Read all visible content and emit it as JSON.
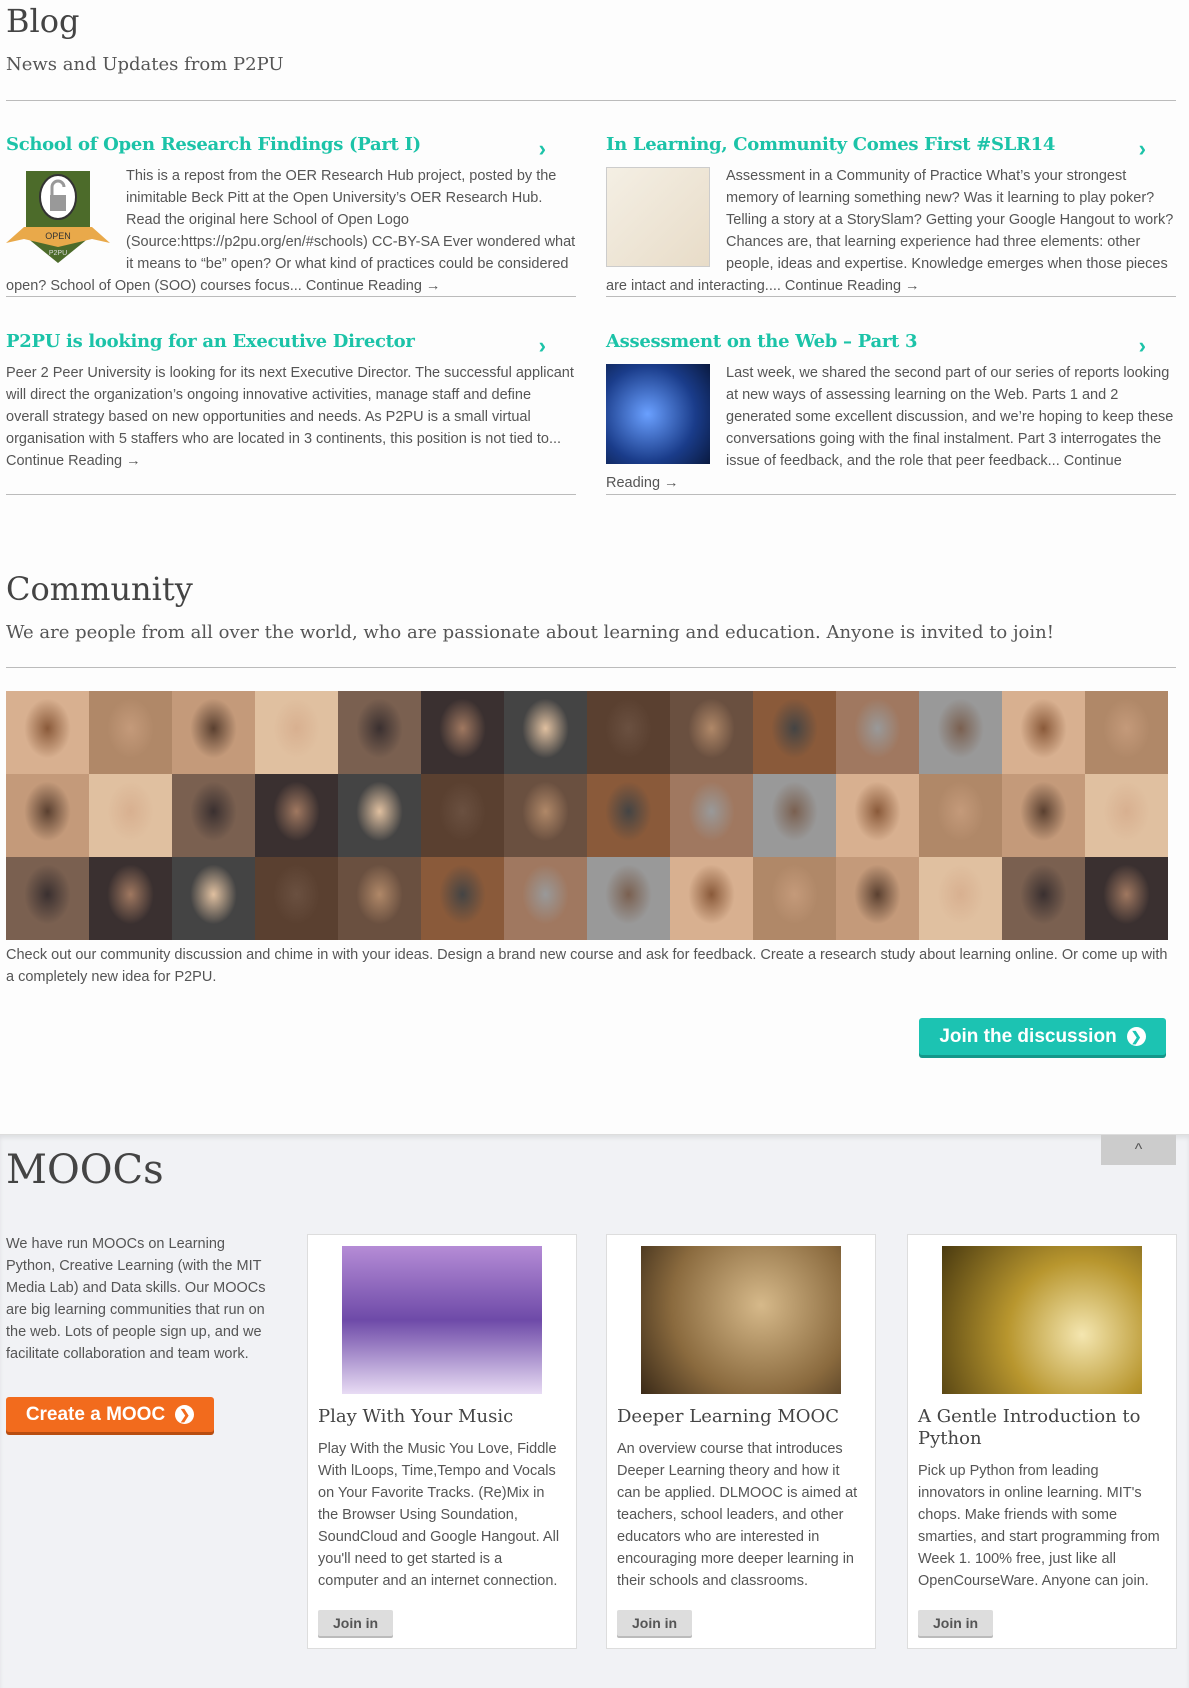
{
  "blog": {
    "title": "Blog",
    "subtitle": "News and Updates from P2PU",
    "posts": [
      {
        "title": "School of Open Research Findings (Part I)",
        "text": "This is a repost from the OER Research Hub project, posted by the inimitable Beck Pitt at the Open University’s OER Research Hub. Read the original here   School of Open Logo (Source:https://p2pu.org/en/#schools) CC-BY-SA Ever wondered what it means to “be” open? Or what kind of practices could be considered open? School of Open (SOO) courses focus... Continue Reading →",
        "badge_top": "OPEN",
        "badge_bottom": "P2PU"
      },
      {
        "title": "In Learning, Community Comes First #SLR14",
        "text": "  Assessment in a Community of Practice What’s your strongest memory of learning something new? Was it learning to play poker? Telling a story at a StorySlam? Getting your Google Hangout to work? Chances are, that learning experience had three elements: other people, ideas and expertise. Knowledge emerges when those pieces are intact and interacting.... Continue Reading →"
      },
      {
        "title": "P2PU is looking for an Executive Director",
        "text": "Peer 2 Peer University is looking for its next Executive Director. The successful applicant will direct the organization’s ongoing innovative activities, manage staff and define overall strategy based on new opportunities and needs. As P2PU is a small virtual organisation with 5 staffers who are located in 3 continents, this position is not tied to... Continue Reading →"
      },
      {
        "title": "Assessment on the Web – Part 3",
        "text": "Last week, we shared the second part of our series of reports looking at new ways of assessing learning on the Web. Parts 1 and 2 generated some excellent discussion, and we’re hoping to keep these conversations going with the final instalment. Part 3 interrogates the issue of feedback, and the role that peer feedback... Continue Reading →"
      }
    ]
  },
  "community": {
    "title": "Community",
    "subtitle": "We are people from all over the world, who are passionate about learning and education. Anyone is invited to join!",
    "text": "Check out our community discussion and chime in with your ideas. Design a brand new course and ask for feedback. Create a research study about learning online. Or come up with a completely new idea for P2PU.",
    "button": "Join the discussion",
    "accent": "#1cc3b2"
  },
  "moocs": {
    "title": "MOOCs",
    "text": "We have run MOOCs on Learning Python, Creative Learning (with the MIT Media Lab) and Data skills. Our MOOCs are big learning communities that run on the web. Lots of people sign up, and we facilitate collaboration and team work.",
    "button": "Create a MOOC",
    "accent": "#f26b1d",
    "cards": [
      {
        "title": "Play With Your Music",
        "text": "Play With the Music You Love, Fiddle With lLoops, Time,Tempo and Vocals on Your Favorite Tracks. (Re)Mix in the Browser Using Soundation, SoundCloud and Google Hangout. All you'll need to get started is a computer and an internet connection.",
        "button": "Join in"
      },
      {
        "title": "Deeper Learning MOOC",
        "text": "An overview course that introduces Deeper Learning theory and how it can be applied. DLMOOC is aimed at teachers, school leaders, and other educators who are interested in encouraging more deeper learning in their schools and classrooms.",
        "button": "Join in"
      },
      {
        "title": "A Gentle Introduction to Python",
        "text": "Pick up Python from leading innovators in online learning. MIT's chops. Make friends with some smarties, and start programming from Week 1. 100% free, just like all OpenCourseWare. Anyone can join.",
        "button": "Join in"
      }
    ]
  }
}
